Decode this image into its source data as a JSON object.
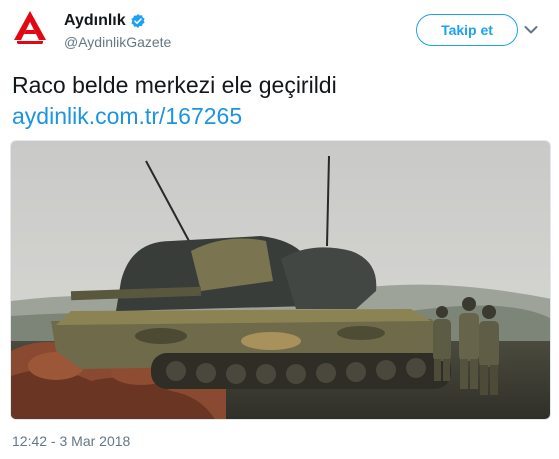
{
  "account": {
    "display_name": "Aydınlık",
    "handle": "@AydinlikGazete",
    "verified": true,
    "avatar_letter": "A",
    "avatar_icon": "aydinlik-logo-icon"
  },
  "actions": {
    "follow_label": "Takip et",
    "more_icon": "chevron-down-icon"
  },
  "tweet": {
    "text": "Raco belde merkezi ele geçirildi",
    "link": "aydinlik.com.tr/167265",
    "timestamp": "12:42 - 3 Mar 2018"
  },
  "colors": {
    "brand_blue": "#1da1f2",
    "link_blue": "#1b95e0",
    "logo_red": "#e30613",
    "muted": "#657786"
  }
}
